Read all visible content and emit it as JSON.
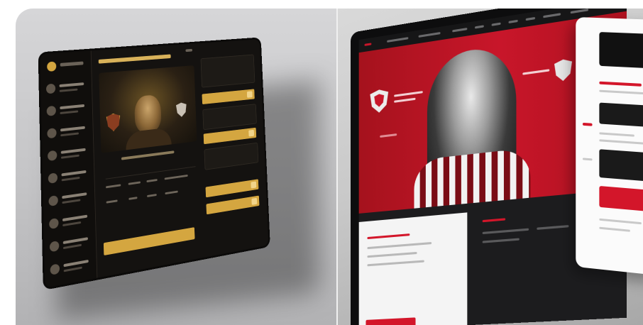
{
  "scene": {
    "left_panel": {
      "theme": "dark-gold",
      "device": "tablet",
      "accent": "#d4a640",
      "background": "#141210"
    },
    "right_panel": {
      "theme": "red-white",
      "device": "desktop-monitor-and-phone",
      "accent": "#c8162a",
      "background": "#1a1a1c"
    }
  },
  "icons": {
    "tablet_logo": "club-logo-icon",
    "tablet_crest_left": "club-crest-icon",
    "tablet_crest_right": "opponent-crest-icon",
    "monitor_crest": "club-crest-icon",
    "monitor_crest_right": "opponent-crest-icon"
  }
}
